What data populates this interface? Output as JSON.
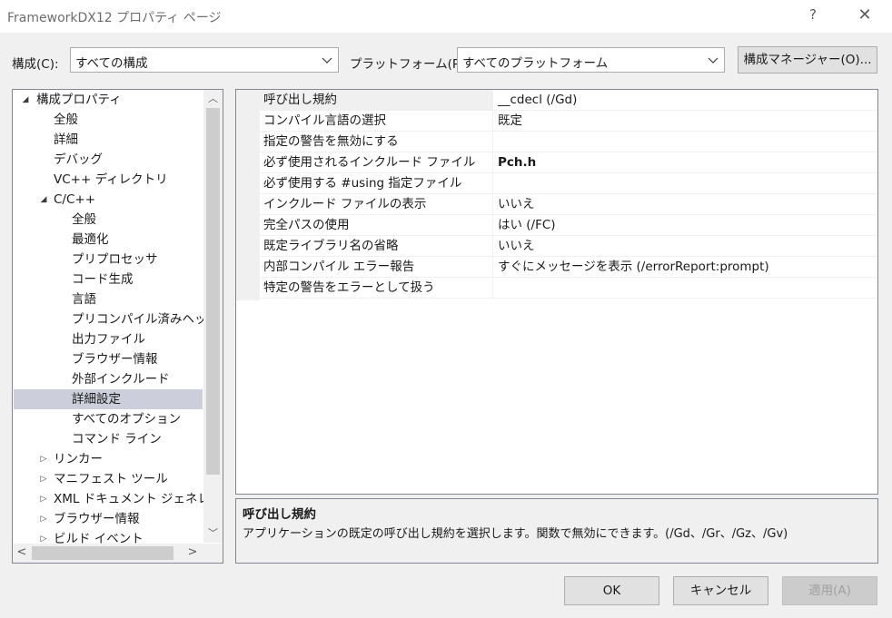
{
  "window": {
    "title": "FrameworkDX12 プロパティ ページ",
    "help_glyph": "?",
    "close_glyph": "✕"
  },
  "toolbar": {
    "config_label": "構成(C):",
    "config_value": "すべての構成",
    "platform_label": "プラットフォーム(P):",
    "platform_value": "すべてのプラットフォーム",
    "config_manager_button": "構成マネージャー(O)..."
  },
  "tree": {
    "items": [
      {
        "label": "構成プロパティ",
        "toggle": "◢"
      },
      {
        "label": "全般",
        "toggle": ""
      },
      {
        "label": "詳細",
        "toggle": ""
      },
      {
        "label": "デバッグ",
        "toggle": ""
      },
      {
        "label": "VC++ ディレクトリ",
        "toggle": ""
      },
      {
        "label": "C/C++",
        "toggle": "◢"
      },
      {
        "label": "全般",
        "toggle": ""
      },
      {
        "label": "最適化",
        "toggle": ""
      },
      {
        "label": "プリプロセッサ",
        "toggle": ""
      },
      {
        "label": "コード生成",
        "toggle": ""
      },
      {
        "label": "言語",
        "toggle": ""
      },
      {
        "label": "プリコンパイル済みヘッダー",
        "toggle": ""
      },
      {
        "label": "出力ファイル",
        "toggle": ""
      },
      {
        "label": "ブラウザー情報",
        "toggle": ""
      },
      {
        "label": "外部インクルード",
        "toggle": ""
      },
      {
        "label": "詳細設定",
        "toggle": ""
      },
      {
        "label": "すべてのオプション",
        "toggle": ""
      },
      {
        "label": "コマンド ライン",
        "toggle": ""
      },
      {
        "label": "リンカー",
        "toggle": "▷"
      },
      {
        "label": "マニフェスト ツール",
        "toggle": "▷"
      },
      {
        "label": "XML ドキュメント ジェネレーター",
        "toggle": "▷"
      },
      {
        "label": "ブラウザー情報",
        "toggle": "▷"
      },
      {
        "label": "ビルド イベント",
        "toggle": "▷"
      }
    ],
    "selected_label": "詳細設定",
    "scroll_up": "︿",
    "scroll_down": "﹀",
    "scroll_left": "<",
    "scroll_right": ">"
  },
  "properties": [
    {
      "name": "呼び出し規約",
      "value": "__cdecl (/Gd)"
    },
    {
      "name": "コンパイル言語の選択",
      "value": "既定"
    },
    {
      "name": "指定の警告を無効にする",
      "value": ""
    },
    {
      "name": "必ず使用されるインクルード ファイル",
      "value": "Pch.h"
    },
    {
      "name": "必ず使用する #using 指定ファイル",
      "value": ""
    },
    {
      "name": "インクルード ファイルの表示",
      "value": "いいえ"
    },
    {
      "name": "完全パスの使用",
      "value": "はい (/FC)"
    },
    {
      "name": "既定ライブラリ名の省略",
      "value": "いいえ"
    },
    {
      "name": "内部コンパイル エラー報告",
      "value": "すぐにメッセージを表示 (/errorReport:prompt)"
    },
    {
      "name": "特定の警告をエラーとして扱う",
      "value": ""
    }
  ],
  "description": {
    "title": "呼び出し規約",
    "text": "アプリケーションの既定の呼び出し規約を選択します。関数で無効にできます。(/Gd、/Gr、/Gz、/Gv)"
  },
  "buttons": {
    "ok": "OK",
    "cancel": "キャンセル",
    "apply": "適用(A)"
  },
  "colors": {
    "selection": "#cccedb",
    "disabled_text": "#a0a0a0",
    "window_bg": "#f0f0f0",
    "border": "#828790"
  },
  "icons": {
    "expanded": "expanded-triangle-icon",
    "collapsed": "collapsed-triangle-icon",
    "dropdown": "chevron-down-icon"
  }
}
